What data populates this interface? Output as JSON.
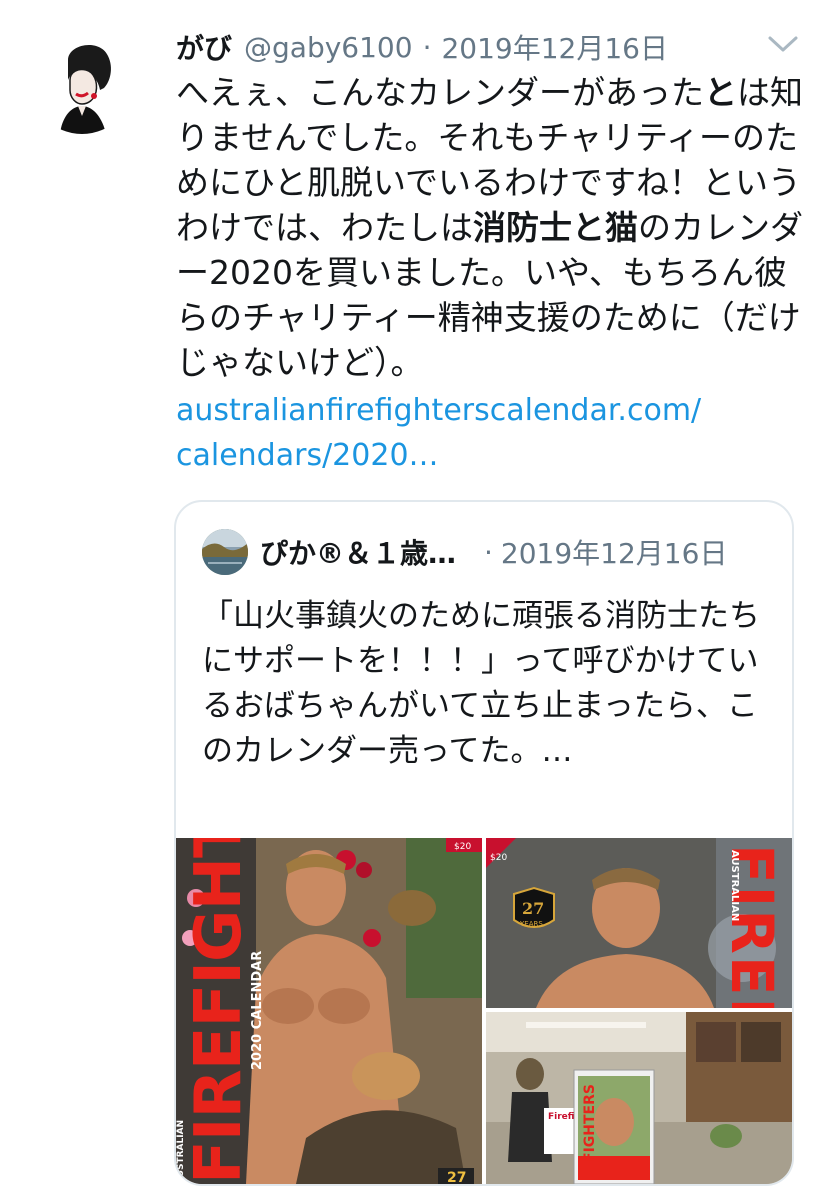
{
  "tweet": {
    "author_name": "がび",
    "author_handle": "@gaby6100",
    "separator": "·",
    "date": "2019年12月16日",
    "text_parts": [
      {
        "text": "へえぇ、こんなカレンダーがあった",
        "bold": false
      },
      {
        "text": "と",
        "bold": true
      },
      {
        "text": "は知りませんでした。それもチャリティーのためにひと肌脱いでいるわけですね！というわけでは、わたしは",
        "bold": false
      },
      {
        "text": "消防士と猫",
        "bold": true
      },
      {
        "text": "のカレンダー2020を買いました。いや、もちろん彼らのチャリティー精神支援のために（だけじゃないけど）。",
        "bold": false
      }
    ],
    "link_line1": "australianfirefighterscalendar.com/",
    "link_line2": "calendars/2020…",
    "icons": {
      "menu": "chevron-down-icon",
      "avatar": "woman-silhouette-avatar"
    }
  },
  "quoted": {
    "author_name": "ぴか®＆１歳…",
    "separator": "·",
    "date": "2019年12月16日",
    "text": "「山火事鎮火のために頑張る消防士たちにサポートを！！！」って呼びかけているおばちゃんがいて立ち止まったら、このカレンダー売ってた。…",
    "media": {
      "photo1": {
        "title": "FIREFIGHTERS",
        "subtitle": "2020 CALENDAR",
        "side": "AUSTRALIAN",
        "badge": "27",
        "price": "$20"
      },
      "photo2": {
        "title": "FIREFI",
        "side": "AUSTRALIAN",
        "badge": "27",
        "badge_sub": "YEARS",
        "price": "$20"
      },
      "photo3": {
        "sign": "FIGHTERS",
        "brand": "Firefi"
      }
    }
  },
  "colors": {
    "text": "#14171a",
    "muted": "#657786",
    "link": "#1b95e0",
    "border": "#e1e8ed"
  }
}
